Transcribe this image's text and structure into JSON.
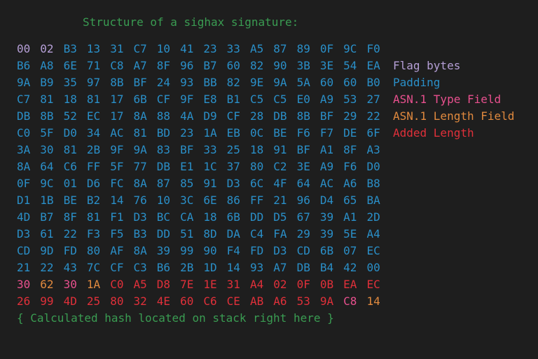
{
  "title": "Structure of a sighax signature:",
  "footer": "{ Calculated hash located on stack right here }",
  "colors": {
    "title": "#3a9c52",
    "footer": "#3a9c52",
    "flag": "#b59fd6",
    "padding": "#2a8fc8",
    "asn_type": "#e8508e",
    "asn_length": "#e0893e",
    "added_length": "#e0303a"
  },
  "legend": [
    {
      "label": "Flag bytes",
      "category": "flag"
    },
    {
      "label": "Padding",
      "category": "padding"
    },
    {
      "label": "ASN.1 Type Field",
      "category": "asn_type"
    },
    {
      "label": "ASN.1 Length Field",
      "category": "asn_length"
    },
    {
      "label": "Added Length",
      "category": "added_length"
    }
  ],
  "rows": [
    "00 02 B3 13 31 C7 10 41 23 33 A5 87 89 0F 9C F0",
    "B6 A8 6E 71 C8 A7 8F 96 B7 60 82 90 3B 3E 54 EA",
    "9A B9 35 97 8B BF 24 93 BB 82 9E 9A 5A 60 60 B0",
    "C7 81 18 81 17 6B CF 9F E8 B1 C5 C5 E0 A9 53 27",
    "DB 8B 52 EC 17 8A 88 4A D9 CF 28 DB 8B BF 29 22",
    "C0 5F D0 34 AC 81 BD 23 1A EB 0C BE F6 F7 DE 6F",
    "3A 30 81 2B 9F 9A 83 BF 33 25 18 91 BF A1 8F A3",
    "8A 64 C6 FF 5F 77 DB E1 1C 37 80 C2 3E A9 F6 D0",
    "0F 9C 01 D6 FC 8A 87 85 91 D3 6C 4F 64 AC A6 B8",
    "D1 1B BE B2 14 76 10 3C 6E 86 FF 21 96 D4 65 BA",
    "4D B7 8F 81 F1 D3 BC CA 18 6B DD D5 67 39 A1 2D",
    "D3 61 22 F3 F5 B3 DD 51 8D DA C4 FA 29 39 5E A4",
    "CD 9D FD 80 AF 8A 39 99 90 F4 FD D3 CD 6B 07 EC",
    "21 22 43 7C CF C3 B6 2B 1D 14 93 A7 DB B4 42 00",
    "30 62 30 1A C0 A5 D8 7E 1E 31 A4 02 0F 0B EA EC",
    "26 99 4D 25 80 32 4E 60 C6 CE AB A6 53 9A C8 14"
  ],
  "byte_categories": {
    "0": [
      "flag",
      "flag",
      "padding",
      "padding",
      "padding",
      "padding",
      "padding",
      "padding",
      "padding",
      "padding",
      "padding",
      "padding",
      "padding",
      "padding",
      "padding",
      "padding"
    ],
    "14": [
      "asn_type",
      "asn_length",
      "asn_type",
      "asn_length",
      "added_length",
      "added_length",
      "added_length",
      "added_length",
      "added_length",
      "added_length",
      "added_length",
      "added_length",
      "added_length",
      "added_length",
      "added_length",
      "added_length"
    ],
    "15": [
      "added_length",
      "added_length",
      "added_length",
      "added_length",
      "added_length",
      "added_length",
      "added_length",
      "added_length",
      "added_length",
      "added_length",
      "added_length",
      "added_length",
      "added_length",
      "added_length",
      "asn_type",
      "asn_length"
    ]
  },
  "default_category": "padding"
}
